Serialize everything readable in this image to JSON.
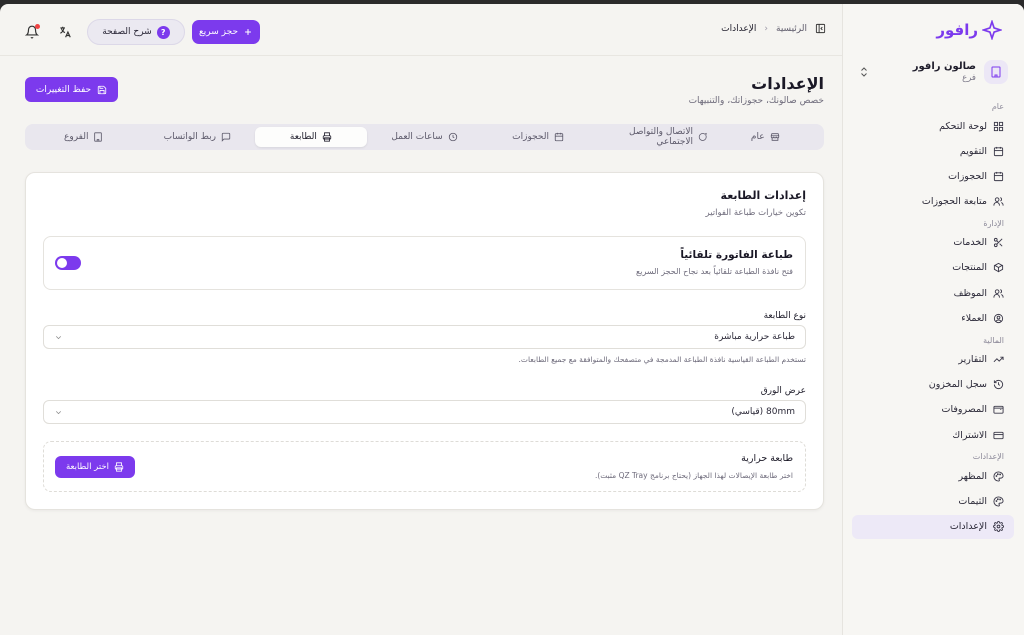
{
  "brand": {
    "name": "رافور"
  },
  "branch": {
    "name": "صالون رافور",
    "type": "فرع"
  },
  "sidebar": {
    "sections": [
      {
        "label": "عام",
        "items": [
          {
            "label": "لوحة التحكم",
            "icon": "dashboard-icon"
          },
          {
            "label": "التقويم",
            "icon": "calendar-icon"
          },
          {
            "label": "الحجوزات",
            "icon": "calendar-icon"
          },
          {
            "label": "متابعة الحجوزات",
            "icon": "users-icon"
          }
        ]
      },
      {
        "label": "الإدارة",
        "items": [
          {
            "label": "الخدمات",
            "icon": "scissors-icon"
          },
          {
            "label": "المنتجات",
            "icon": "package-icon"
          },
          {
            "label": "الموظف",
            "icon": "users-icon"
          },
          {
            "label": "العملاء",
            "icon": "user-circle-icon"
          }
        ]
      },
      {
        "label": "المالية",
        "items": [
          {
            "label": "التقارير",
            "icon": "trending-icon"
          },
          {
            "label": "سجل المخزون",
            "icon": "history-icon"
          },
          {
            "label": "المصروفات",
            "icon": "wallet-icon"
          },
          {
            "label": "الاشتراك",
            "icon": "credit-card-icon"
          }
        ]
      },
      {
        "label": "الإعدادات",
        "items": [
          {
            "label": "المظهر",
            "icon": "palette-icon"
          },
          {
            "label": "الثيمات",
            "icon": "palette-icon"
          },
          {
            "label": "الإعدادات",
            "icon": "gear-icon",
            "active": true
          }
        ]
      }
    ]
  },
  "breadcrumb": {
    "home": "الرئيسية",
    "current": "الإعدادات"
  },
  "topbar": {
    "quick_booking": "حجز سريع",
    "explain_page": "شرح الصفحة"
  },
  "page": {
    "title": "الإعدادات",
    "subtitle": "خصص صالونك، حجوزاتك، والتنبيهات",
    "save_label": "حفظ التغييرات"
  },
  "tabs": [
    {
      "label": "عام",
      "icon": "store-icon"
    },
    {
      "label": "الاتصال والتواصل الاجتماعي",
      "icon": "chat-icon"
    },
    {
      "label": "الحجوزات",
      "icon": "calendar-icon"
    },
    {
      "label": "ساعات العمل",
      "icon": "clock-icon"
    },
    {
      "label": "الطابعة",
      "icon": "printer-icon",
      "active": true
    },
    {
      "label": "ربط الواتساب",
      "icon": "message-icon"
    },
    {
      "label": "الفروع",
      "icon": "building-icon"
    }
  ],
  "printer": {
    "title": "إعدادات الطابعة",
    "subtitle": "تكوين خيارات طباعة الفواتير",
    "auto_print": {
      "title": "طباعة الفاتورة تلقائياً",
      "description": "فتح نافذة الطباعة تلقائياً بعد نجاح الحجز السريع",
      "enabled": true
    },
    "printer_type": {
      "label": "نوع الطابعة",
      "value": "طباعة حرارية مباشرة",
      "hint": "تستخدم الطباعة القياسية نافذة الطباعة المدمجة في متصفحك والمتوافقة مع جميع الطابعات."
    },
    "paper_width": {
      "label": "عرض الورق",
      "value": "80mm (قياسي)"
    },
    "thermal": {
      "title": "طابعة حرارية",
      "description": "اختر طابعة الإيصالات لهذا الجهاز (يحتاج برنامج QZ Tray مثبت).",
      "button": "اختر الطابعة"
    }
  },
  "colors": {
    "accent": "#7c3aed",
    "background": "#f5f4f1"
  }
}
